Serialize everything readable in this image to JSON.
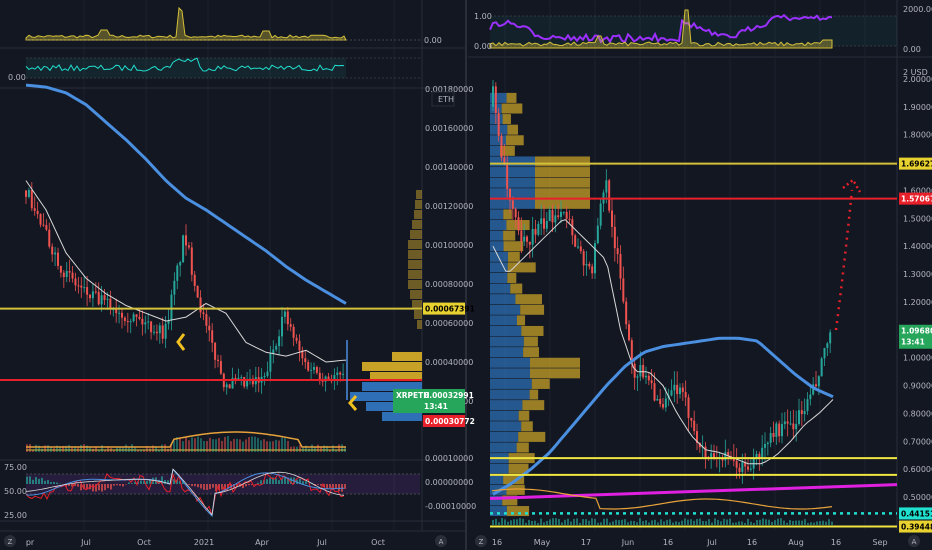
{
  "colors": {
    "bg": "#131722",
    "grid": "#1e222d",
    "divider": "#2a2e39",
    "text": "#b2b5be",
    "yellow": "#d4c13a",
    "red": "#e8202a",
    "blue": "#4a8fe0",
    "white_ma": "#d8d8d8",
    "orange": "#e7a23a",
    "magenta": "#e020e0",
    "purple": "#9b30ff",
    "cyan": "#20e0d0",
    "green_tag": "#26a65b",
    "candle_up": "#26a69a",
    "candle_down": "#ef5350",
    "vp_blue": "#2e6fb6",
    "vp_gold": "#c8a227"
  },
  "left": {
    "symbol": "XRPETH",
    "currency": "ETH",
    "top_volume_label": "0.00",
    "top_osc_label": "0.00",
    "price_axis": [
      "0.00180000",
      "0.00160000",
      "0.00140000",
      "0.00120000",
      "0.00100000",
      "0.00080000",
      "0.00060000",
      "0.00040000",
      "0.00020000"
    ],
    "macd_axis": [
      "0.00010000",
      "0.00000000",
      "-0.00010000"
    ],
    "rsi_axis": [
      "75.00",
      "50.00",
      "25.00"
    ],
    "time_axis": [
      "pr",
      "Jul",
      "Oct",
      "2021",
      "Apr",
      "Jul",
      "Oct"
    ],
    "tags": {
      "yellow_level": "0.00067391",
      "price": "0.00032991",
      "countdown": "13:41",
      "red_level": "0.00030772"
    },
    "chart_data": {
      "type": "line",
      "title": "",
      "price_range": [
        0.0,
        0.002
      ],
      "series": [
        {
          "name": "",
          "kind": "MA-slow",
          "values": [
            0.00182,
            0.00181,
            0.00178,
            0.00172,
            0.00163,
            0.00154,
            0.00144,
            0.00133,
            0.00124,
            0.00118,
            0.00111,
            0.00104,
            0.00097,
            0.00089,
            0.00082,
            0.00076,
            0.0007
          ]
        },
        {
          "name": "",
          "kind": "MA-fast",
          "values": [
            0.00133,
            0.00118,
            0.00096,
            0.00083,
            0.00075,
            0.00069,
            0.00065,
            0.00061,
            0.00063,
            0.0007,
            0.00065,
            0.0005,
            0.00045,
            0.00043,
            0.00046,
            0.0004,
            0.00041
          ]
        },
        {
          "name": "",
          "kind": "close",
          "values": [
            0.00128,
            0.00105,
            0.00085,
            0.00075,
            0.0007,
            0.00065,
            0.0006,
            0.00055,
            0.00105,
            0.0006,
            0.0003,
            0.00028,
            0.0003,
            0.00065,
            0.0004,
            0.00033,
            0.00032
          ]
        }
      ],
      "levels": [
        0.00067391,
        0.00030772
      ]
    }
  },
  "right": {
    "currency": "USD",
    "top_axis": [
      "1.00",
      "0.00"
    ],
    "top_axis_right": [
      "2000.00",
      "0.00"
    ],
    "price_axis": [
      "2 USD",
      "2.00000",
      "1.90000",
      "1.80000",
      "1.70000",
      "1.60000",
      "1.50000",
      "1.40000",
      "1.30000",
      "1.20000",
      "1.10000",
      "1.00000",
      "0.90000",
      "0.80000",
      "0.70000",
      "0.60000",
      "0.50000"
    ],
    "time_axis": [
      "16",
      "May",
      "17",
      "Jun",
      "16",
      "Jul",
      "16",
      "Aug",
      "16",
      "Sep"
    ],
    "tags": {
      "yellow_level": "1.69627",
      "red_level": "1.57067",
      "price": "1.09680",
      "countdown": "13:41",
      "cyan_level": "0.44151",
      "bottom_yellow": "0.39448"
    },
    "chart_data": {
      "type": "line",
      "title": "",
      "price_range": [
        0.4,
        2.05
      ],
      "series": [
        {
          "name": "",
          "kind": "close",
          "values": [
            1.95,
            1.6,
            1.4,
            1.45,
            1.5,
            1.55,
            1.4,
            1.3,
            1.65,
            1.3,
            0.95,
            0.95,
            0.8,
            0.9,
            0.8,
            0.65,
            0.65,
            0.62,
            0.6,
            0.65,
            0.74,
            0.75,
            0.8,
            0.9,
            1.09
          ]
        },
        {
          "name": "",
          "kind": "MA-fast",
          "values": [
            1.4,
            1.3,
            1.35,
            1.4,
            1.45,
            1.5,
            1.45,
            1.4,
            1.35,
            1.1,
            0.95,
            0.95,
            0.9,
            0.8,
            0.72,
            0.67,
            0.66,
            0.64,
            0.62,
            0.62,
            0.65,
            0.7,
            0.76,
            0.8,
            0.85
          ]
        },
        {
          "name": "",
          "kind": "MA-slow",
          "values": [
            0.51,
            0.55,
            0.6,
            0.66,
            0.74,
            0.82,
            0.9,
            0.97,
            1.02,
            1.04,
            1.05,
            1.06,
            1.07,
            1.07,
            1.06,
            1.0,
            0.94,
            0.89,
            0.86
          ]
        }
      ],
      "levels": [
        1.69627,
        1.57067,
        0.64,
        0.58,
        0.44151,
        0.39448
      ]
    }
  }
}
